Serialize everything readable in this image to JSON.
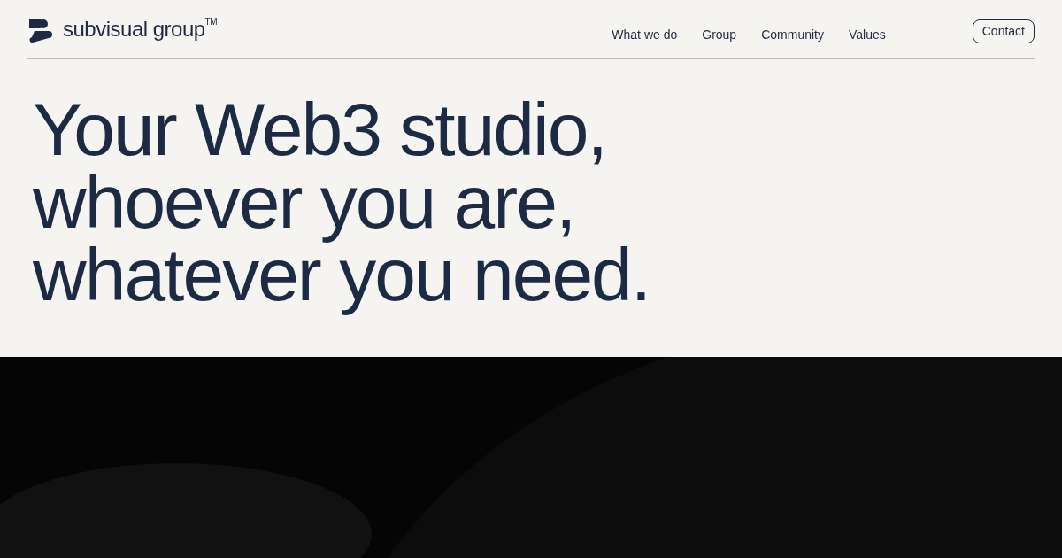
{
  "header": {
    "logo": "subvisual group$^{TM}$",
    "nav": [
      {
        "label": "What we do"
      },
      {
        "label": "Group"
      },
      {
        "label": "Community"
      },
      {
        "label": "Values"
      }
    ],
    "contact": "Contact"
  },
  "hero": {
    "headline": [
      "Your Web3 studio,",
      "whoever you are,",
      "whatever you need."
    ]
  }
}
